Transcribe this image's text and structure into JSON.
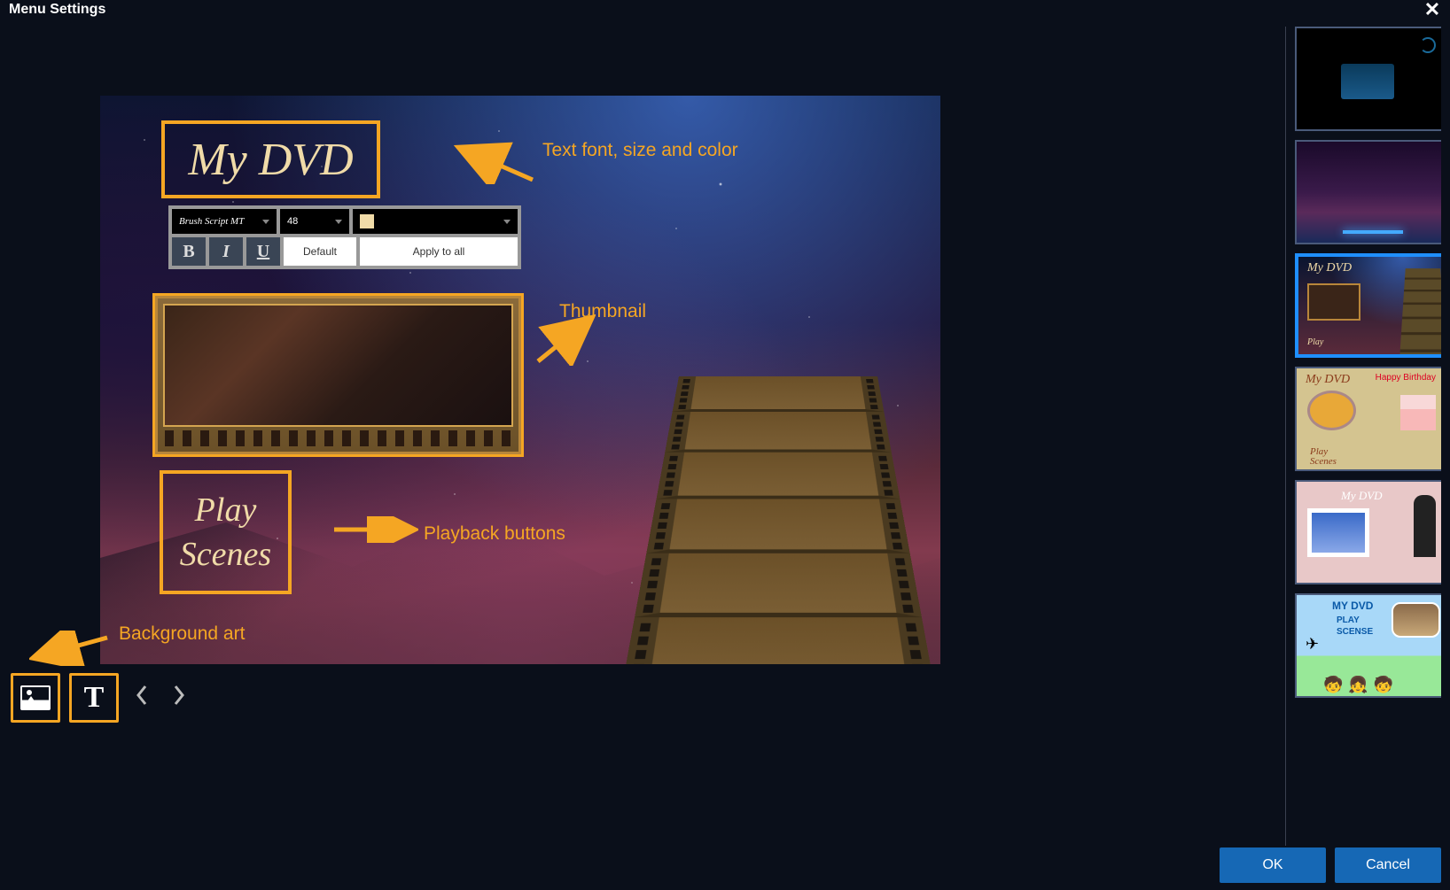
{
  "dialog": {
    "title": "Menu Settings",
    "ok": "OK",
    "cancel": "Cancel"
  },
  "dvd": {
    "title": "My DVD",
    "play": "Play",
    "scenes": "Scenes"
  },
  "toolbar": {
    "font": "Brush Script MT",
    "size": "48",
    "bold": "B",
    "italic": "I",
    "underline": "U",
    "default_btn": "Default",
    "apply_btn": "Apply to all",
    "text_color": "#f0dba8"
  },
  "annotations": {
    "text": "Text font, size and color",
    "thumbnail": "Thumbnail",
    "playback": "Playback buttons",
    "background": "Background art"
  },
  "tools": {
    "text_glyph": "T"
  },
  "templates": {
    "t3_title": "My DVD",
    "t3_btn": "Play",
    "t4_title": "My DVD",
    "t4_balloon": "Happy Birthday",
    "t4_btn_play": "Play",
    "t4_btn_scenes": "Scenes",
    "t5_title": "My DVD",
    "t6_title": "MY DVD",
    "t6_play": "PLAY",
    "t6_scense": "SCENSE"
  }
}
